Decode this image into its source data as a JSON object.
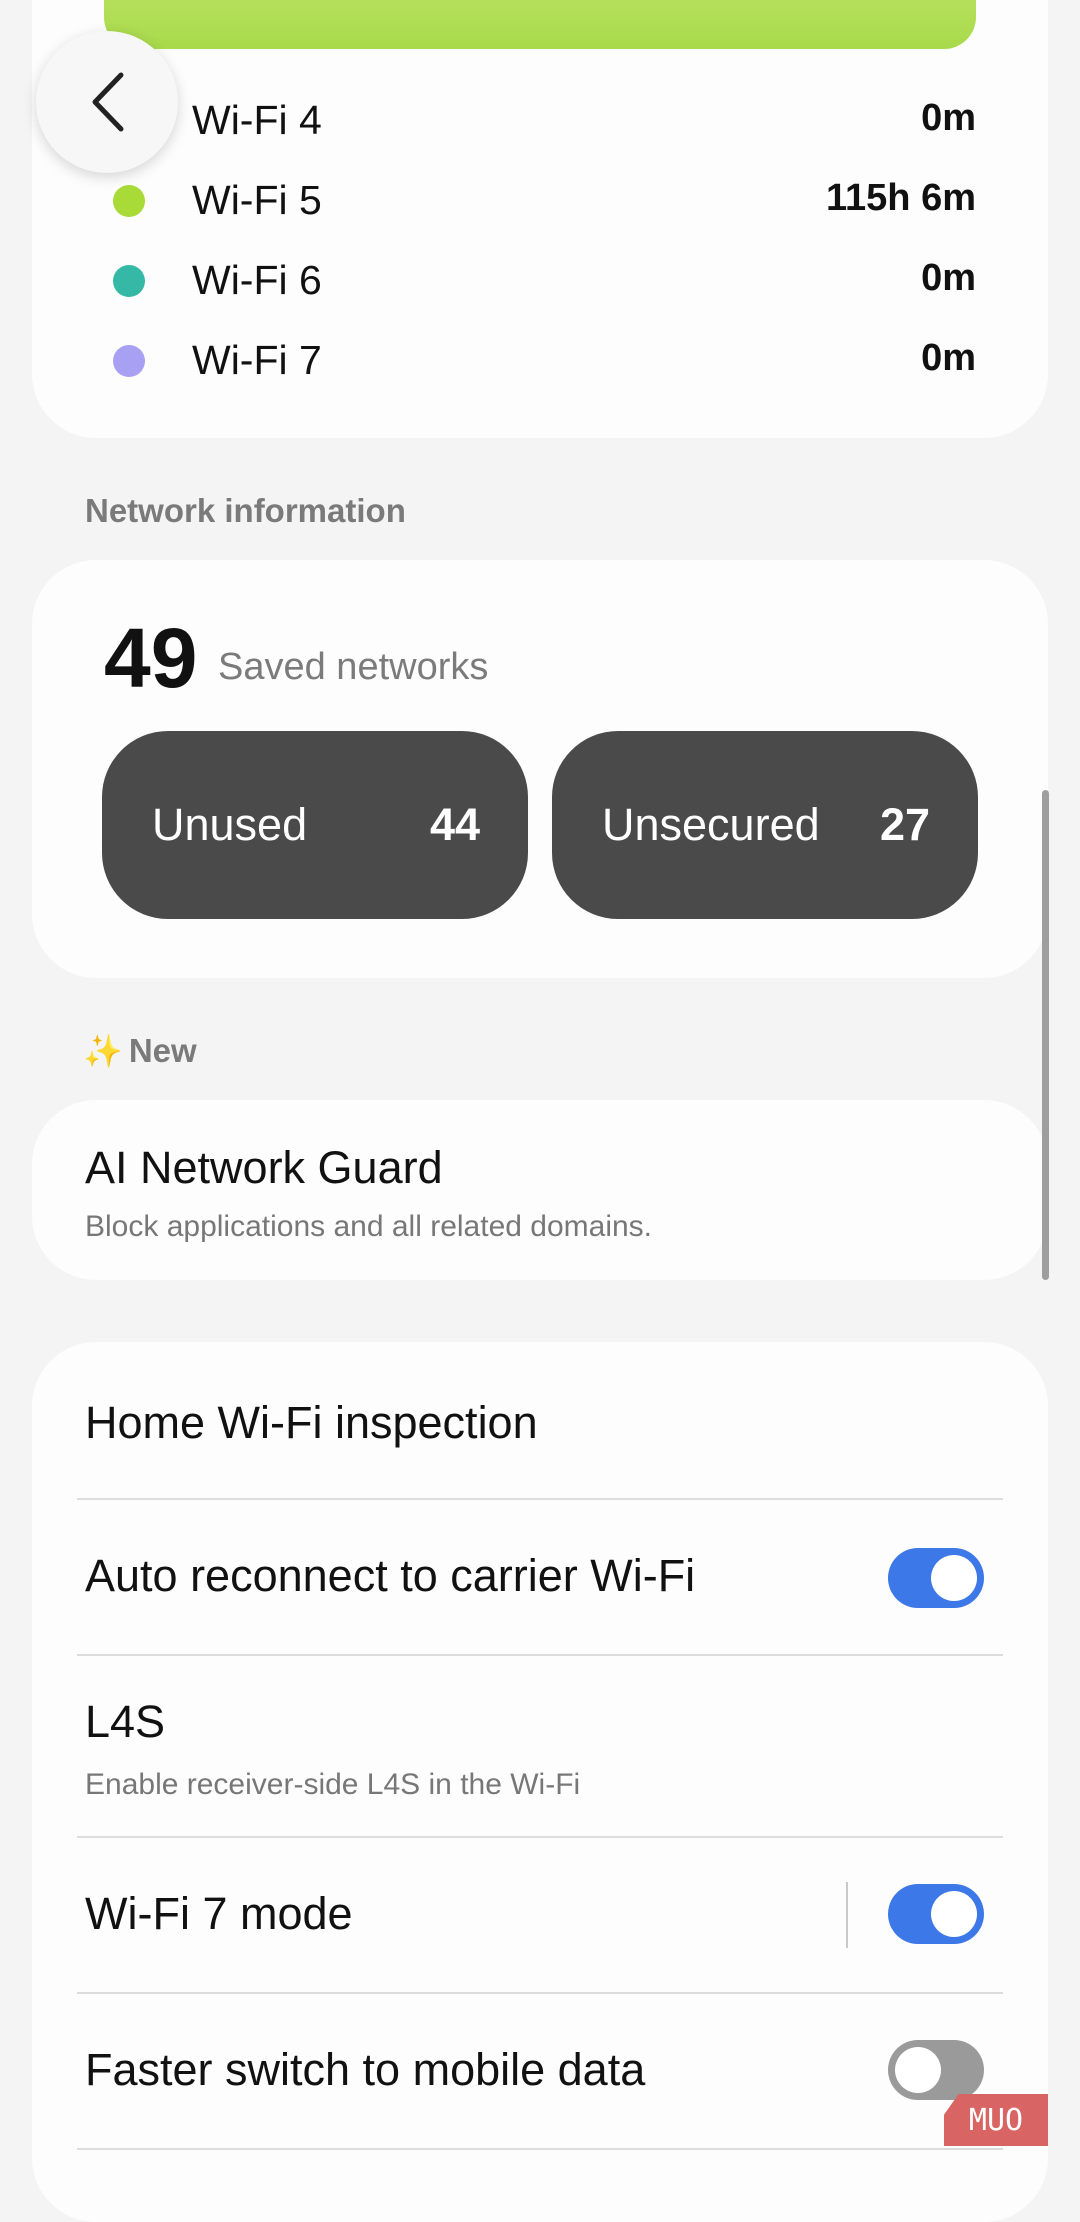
{
  "usage": {
    "rows": [
      {
        "label": "Wi-Fi 4",
        "time": "0m",
        "color": "#ffffff"
      },
      {
        "label": "Wi-Fi 5",
        "time": "115h 6m",
        "color": "#a8da38"
      },
      {
        "label": "Wi-Fi 6",
        "time": "0m",
        "color": "#35b9a6"
      },
      {
        "label": "Wi-Fi 7",
        "time": "0m",
        "color": "#a8a0f2"
      }
    ]
  },
  "network_info": {
    "section_label": "Network information",
    "saved_count": "49",
    "saved_label": "Saved networks",
    "unused_label": "Unused",
    "unused_value": "44",
    "unsecured_label": "Unsecured",
    "unsecured_value": "27"
  },
  "new_section": {
    "sparkle": "✨",
    "label": "New"
  },
  "ai_guard": {
    "title": "AI Network Guard",
    "subtitle": "Block applications and all related domains."
  },
  "settings": {
    "home_inspection": "Home Wi-Fi inspection",
    "auto_reconnect": {
      "title": "Auto reconnect to carrier Wi-Fi",
      "enabled": true
    },
    "l4s": {
      "title": "L4S",
      "subtitle": "Enable receiver-side L4S in the Wi-Fi"
    },
    "wifi7_mode": {
      "title": "Wi-Fi 7 mode",
      "enabled": true
    },
    "faster_switch": {
      "title": "Faster switch to mobile data",
      "enabled": false
    }
  },
  "watermark": "MUO",
  "colors": {
    "accent": "#3c78e8",
    "pill": "#4a4a4a"
  }
}
